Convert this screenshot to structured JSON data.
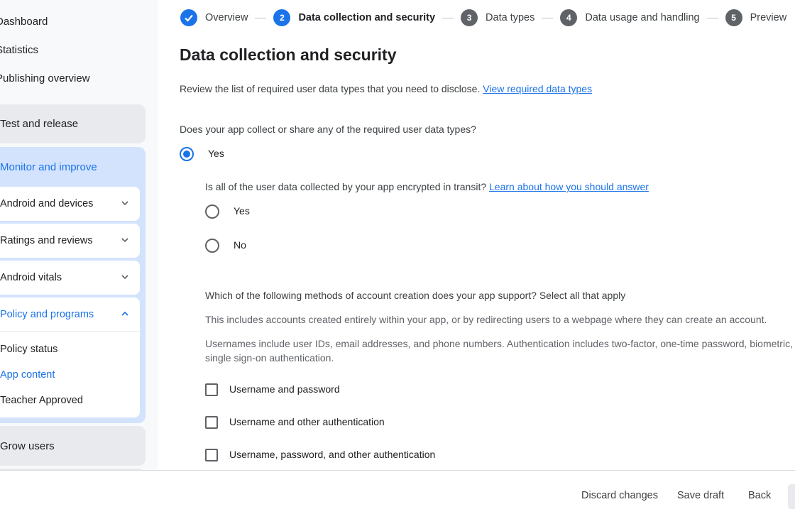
{
  "sidebar": {
    "top_items": [
      "Dashboard",
      "Statistics",
      "Publishing overview"
    ],
    "test_release": "Test and release",
    "monitor": "Monitor and improve",
    "cards": [
      "Android and devices",
      "Ratings and reviews",
      "Android vitals",
      "Policy and programs"
    ],
    "policy_sub": [
      "Policy status",
      "App content",
      "Teacher Approved"
    ],
    "grow": "Grow users"
  },
  "stepper": {
    "steps": [
      {
        "num": "",
        "label": "Overview"
      },
      {
        "num": "2",
        "label": "Data collection and security"
      },
      {
        "num": "3",
        "label": "Data types"
      },
      {
        "num": "4",
        "label": "Data usage and handling"
      },
      {
        "num": "5",
        "label": "Preview"
      }
    ]
  },
  "main": {
    "title": "Data collection and security",
    "intro": "Review the list of required user data types that you need to disclose.",
    "intro_link": "View required data types",
    "q1": "Does your app collect or share any of the required user data types?",
    "q1_yes": "Yes",
    "q2": "Is all of the user data collected by your app encrypted in transit?",
    "q2_link": "Learn about how you should answer",
    "q2_yes": "Yes",
    "q2_no": "No",
    "q3": "Which of the following methods of account creation does your app support? Select all that apply",
    "q3_desc1": "This includes accounts created entirely within your app, or by redirecting users to a webpage where they can create an account.",
    "q3_desc2a": "Usernames include user IDs, email addresses, and phone numbers. Authentication includes two-factor, one-time password, biometric,",
    "q3_desc2b": "single sign-on authentication.",
    "options": [
      "Username and password",
      "Username and other authentication",
      "Username, password, and other authentication"
    ]
  },
  "footer": {
    "discard": "Discard changes",
    "save": "Save draft",
    "back": "Back"
  },
  "colors": {
    "accent": "#1a73e8",
    "sidebar_active": "#d3e3fd",
    "step_future": "#5f6368"
  }
}
